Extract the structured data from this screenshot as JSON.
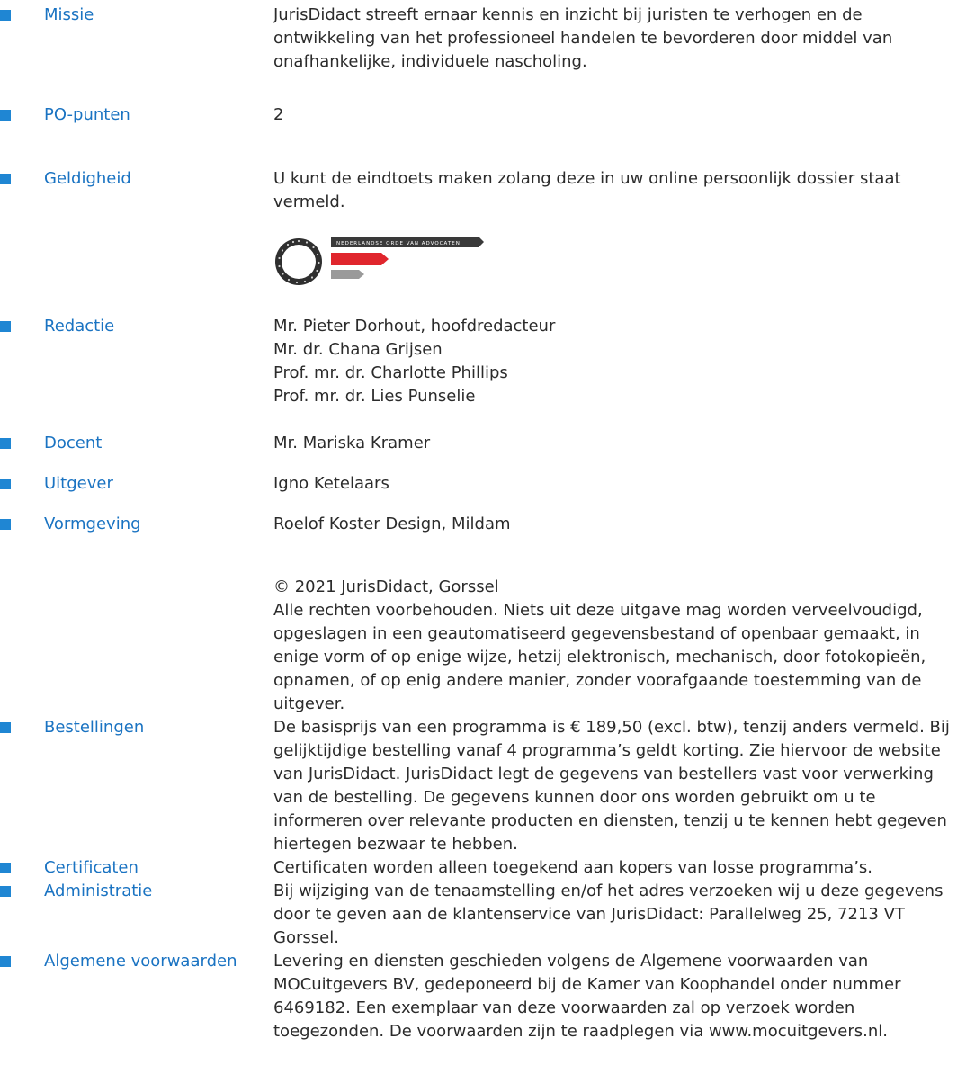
{
  "sections": [
    {
      "label": "Missie",
      "value": "JurisDidact streeft ernaar kennis en inzicht bij juristen te verhogen en de ontwikkeling van het professioneel handelen te bevorderen door middel van onafhankelijke, individuele nascholing."
    },
    {
      "label": "PO-punten",
      "value": "2"
    },
    {
      "label": "Geldigheid",
      "value": "U kunt de eindtoets maken zolang deze in uw online persoonlijk dossier staat vermeld."
    },
    {
      "label": "Redactie",
      "lines": [
        "Mr. Pieter Dorhout, hoofdredacteur",
        "Mr. dr. Chana Grijsen",
        "Prof. mr. dr. Charlotte Phillips",
        "Prof. mr. dr. Lies Punselie"
      ]
    },
    {
      "label": "Docent",
      "value": "Mr. Mariska Kramer"
    },
    {
      "label": "Uitgever",
      "value": "Igno Ketelaars"
    },
    {
      "label": "Vormgeving",
      "value": "Roelof Koster Design, Mildam"
    },
    {
      "label": "Bestellingen",
      "value": "De basisprijs van een programma is € 189,50 (excl. btw), tenzij anders vermeld. Bij gelijktijdige bestelling vanaf 4 programma’s geldt korting. Zie hiervoor de website van JurisDidact. JurisDidact legt de gegevens van bestellers vast voor verwerking van de bestelling. De gegevens kunnen door ons worden gebruikt om u te informeren over relevante producten en diensten, tenzij u te kennen hebt gegeven hiertegen bezwaar te hebben."
    },
    {
      "label": "Certificaten",
      "value": "Certificaten worden alleen toegekend aan kopers van losse programma’s."
    },
    {
      "label": "Administratie",
      "value": "Bij wijziging van de tenaamstelling en/of het adres verzoeken wij u deze gegevens door te geven aan de klantenservice van JurisDidact: Parallelweg 25, 7213 VT Gorssel."
    },
    {
      "label": "Algemene voorwaarden",
      "value": "Levering en diensten geschieden volgens de Algemene voorwaarden van MOCuitgevers BV, gedeponeerd bij de Kamer van Koophandel onder nummer 6469182. Een exemplaar van deze voorwaarden zal op verzoek worden toegezonden. De voorwaarden zijn te raadplegen via www.mocuitgevers.nl."
    }
  ],
  "copyright": {
    "line": "© 2021 JurisDidact, Gorssel",
    "text": "Alle rechten voorbehouden. Niets uit deze uitgave mag worden verveelvoudigd, opgeslagen in een geautomatiseerd gegevensbestand of openbaar gemaakt, in enige vorm of op enige wijze, hetzij elektronisch, mechanisch, door fotokopieën, opnamen, of op enig andere manier, zonder voorafgaande toestemming van de uitgever."
  },
  "logo": {
    "banner_text": "NEDERLANDSE ORDE VAN ADVOCATEN",
    "colors": {
      "dark": "#3a3a3a",
      "red": "#e0262d",
      "gray": "#9a9a9a"
    }
  },
  "colors": {
    "label": "#1a73c2",
    "bullet": "#1f86d3",
    "text": "#2b2b2b"
  }
}
